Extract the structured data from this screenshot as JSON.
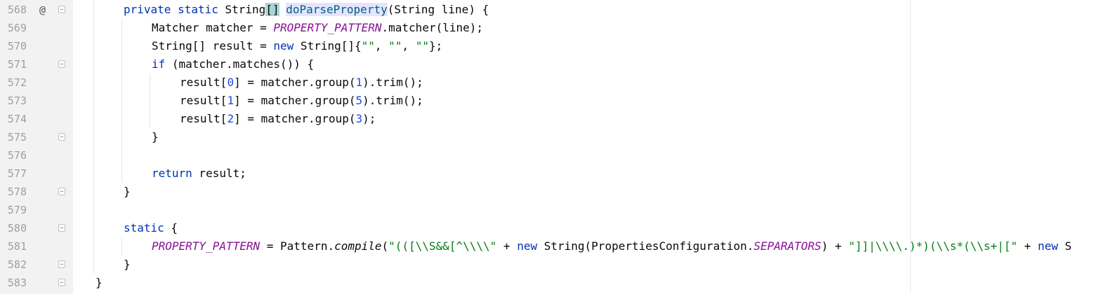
{
  "editor": {
    "lines": [
      {
        "number": "568",
        "marker": "@",
        "fold": true,
        "indent": 1,
        "tokens": [
          {
            "t": "private",
            "c": "kw"
          },
          {
            "t": " "
          },
          {
            "t": "static",
            "c": "kw"
          },
          {
            "t": " String"
          },
          {
            "t": "[]",
            "c": "hl"
          },
          {
            "t": " "
          },
          {
            "t": "caret",
            "c": "caret"
          },
          {
            "t": "doParseProperty",
            "c": "method def-hl"
          },
          {
            "t": "(String line) {"
          }
        ]
      },
      {
        "number": "569",
        "indent": 2,
        "tokens": [
          {
            "t": "Matcher matcher = "
          },
          {
            "t": "PROPERTY_PATTERN",
            "c": "const"
          },
          {
            "t": ".matcher(line);"
          }
        ]
      },
      {
        "number": "570",
        "indent": 2,
        "tokens": [
          {
            "t": "String[] result = "
          },
          {
            "t": "new",
            "c": "kw"
          },
          {
            "t": " String[]{"
          },
          {
            "t": "\"\"",
            "c": "str"
          },
          {
            "t": ", "
          },
          {
            "t": "\"\"",
            "c": "str"
          },
          {
            "t": ", "
          },
          {
            "t": "\"\"",
            "c": "str"
          },
          {
            "t": "};"
          }
        ]
      },
      {
        "number": "571",
        "fold": true,
        "indent": 2,
        "tokens": [
          {
            "t": "if",
            "c": "kw"
          },
          {
            "t": " (matcher.matches()) {"
          }
        ]
      },
      {
        "number": "572",
        "indent": 3,
        "tokens": [
          {
            "t": "result["
          },
          {
            "t": "0",
            "c": "num"
          },
          {
            "t": "] = matcher.group("
          },
          {
            "t": "1",
            "c": "num"
          },
          {
            "t": ").trim();"
          }
        ]
      },
      {
        "number": "573",
        "indent": 3,
        "tokens": [
          {
            "t": "result["
          },
          {
            "t": "1",
            "c": "num"
          },
          {
            "t": "] = matcher.group("
          },
          {
            "t": "5",
            "c": "num"
          },
          {
            "t": ").trim();"
          }
        ]
      },
      {
        "number": "574",
        "indent": 3,
        "tokens": [
          {
            "t": "result["
          },
          {
            "t": "2",
            "c": "num"
          },
          {
            "t": "] = matcher.group("
          },
          {
            "t": "3",
            "c": "num"
          },
          {
            "t": ");"
          }
        ]
      },
      {
        "number": "575",
        "fold": true,
        "indent": 2,
        "tokens": [
          {
            "t": "}"
          }
        ]
      },
      {
        "number": "576",
        "indent": 0,
        "tokens": []
      },
      {
        "number": "577",
        "indent": 2,
        "tokens": [
          {
            "t": "return",
            "c": "kw"
          },
          {
            "t": " result;"
          }
        ]
      },
      {
        "number": "578",
        "fold": true,
        "indent": 1,
        "tokens": [
          {
            "t": "}"
          }
        ]
      },
      {
        "number": "579",
        "indent": 0,
        "tokens": []
      },
      {
        "number": "580",
        "fold": true,
        "indent": 1,
        "tokens": [
          {
            "t": "static",
            "c": "kw"
          },
          {
            "t": " {"
          }
        ]
      },
      {
        "number": "581",
        "indent": 2,
        "tokens": [
          {
            "t": "PROPERTY_PATTERN",
            "c": "const"
          },
          {
            "t": " = Pattern."
          },
          {
            "t": "compile",
            "c": "static"
          },
          {
            "t": "("
          },
          {
            "t": "\"(([\\\\S&&[^\\\\\\\\\"",
            "c": "str"
          },
          {
            "t": " + "
          },
          {
            "t": "new",
            "c": "kw"
          },
          {
            "t": " String(PropertiesConfiguration."
          },
          {
            "t": "SEPARATORS",
            "c": "const"
          },
          {
            "t": ") + "
          },
          {
            "t": "\"]]|\\\\\\\\.)*)(\\\\s*(\\\\s+|[\"",
            "c": "str"
          },
          {
            "t": " + "
          },
          {
            "t": "new",
            "c": "kw"
          },
          {
            "t": " S"
          }
        ]
      },
      {
        "number": "582",
        "fold": true,
        "indent": 1,
        "tokens": [
          {
            "t": "}"
          }
        ]
      },
      {
        "number": "583",
        "fold": true,
        "indent": 0,
        "tokens": [
          {
            "t": "}"
          }
        ]
      }
    ]
  }
}
